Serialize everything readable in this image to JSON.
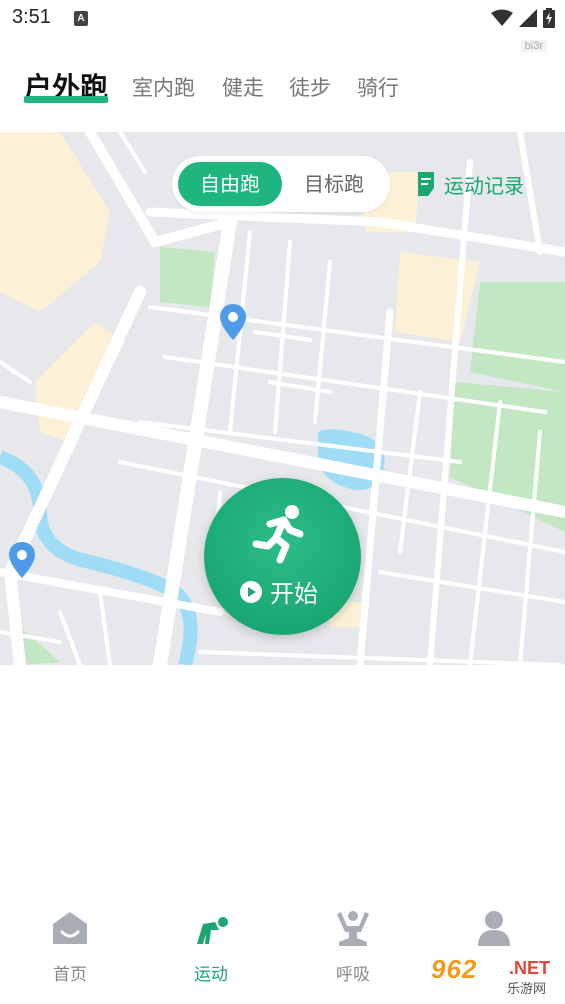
{
  "status_bar": {
    "time": "3:51",
    "notif_icon": "A",
    "icons": [
      "wifi-icon",
      "signal-icon",
      "battery-charging-icon"
    ],
    "watermark": "bi3r"
  },
  "tabs": [
    {
      "label": "户外跑",
      "active": true
    },
    {
      "label": "室内跑",
      "active": false
    },
    {
      "label": "健走",
      "active": false
    },
    {
      "label": "徒步",
      "active": false
    },
    {
      "label": "骑行",
      "active": false
    }
  ],
  "mode_toggle": {
    "free_run": "自由跑",
    "target_run": "目标跑"
  },
  "records_link": "运动记录",
  "start_button": {
    "label": "开始",
    "icon": "runner-icon"
  },
  "bottom_nav": [
    {
      "label": "首页",
      "icon": "home-icon",
      "active": false
    },
    {
      "label": "运动",
      "icon": "exercise-icon",
      "active": true
    },
    {
      "label": "呼吸",
      "icon": "meditation-icon",
      "active": false
    },
    {
      "label": "",
      "icon": "profile-icon",
      "active": false
    }
  ],
  "watermark": {
    "number": "962",
    "suffix": ".NET",
    "site": "乐游网"
  },
  "colors": {
    "accent": "#1fb57f",
    "map_bg": "#e6e8eb",
    "park": "#c3e6c3",
    "building": "#fcf1d6",
    "water": "#9fdcf6",
    "pin": "#4f9be8"
  }
}
